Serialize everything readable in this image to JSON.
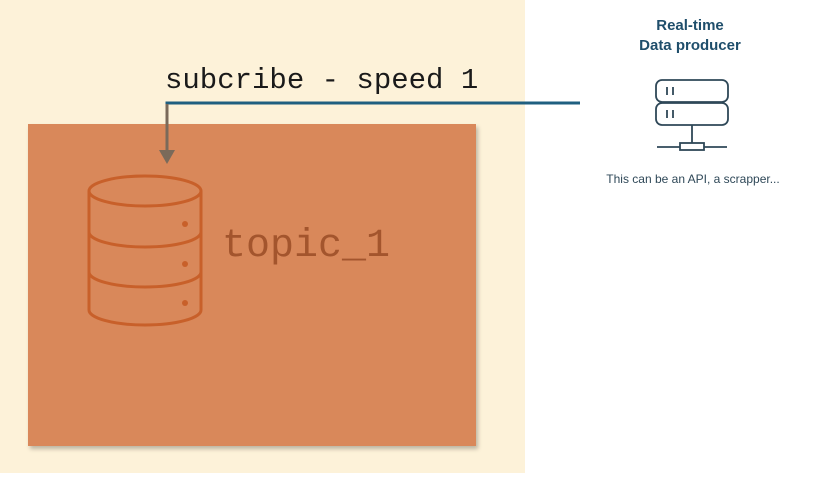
{
  "subscribe": {
    "label": "subcribe - speed 1"
  },
  "topic": {
    "label": "topic_1"
  },
  "producer": {
    "title_line1": "Real-time",
    "title_line2": "Data producer",
    "caption": "This can be an API, a scrapper..."
  },
  "icons": [
    "database-icon",
    "server-icon"
  ],
  "colors": {
    "panel_background": "#fdf2d9",
    "topic_box": "#d9885a",
    "database_stroke": "#c8602a",
    "connector_line": "#1f5f80",
    "arrow": "#7a6a5a"
  }
}
